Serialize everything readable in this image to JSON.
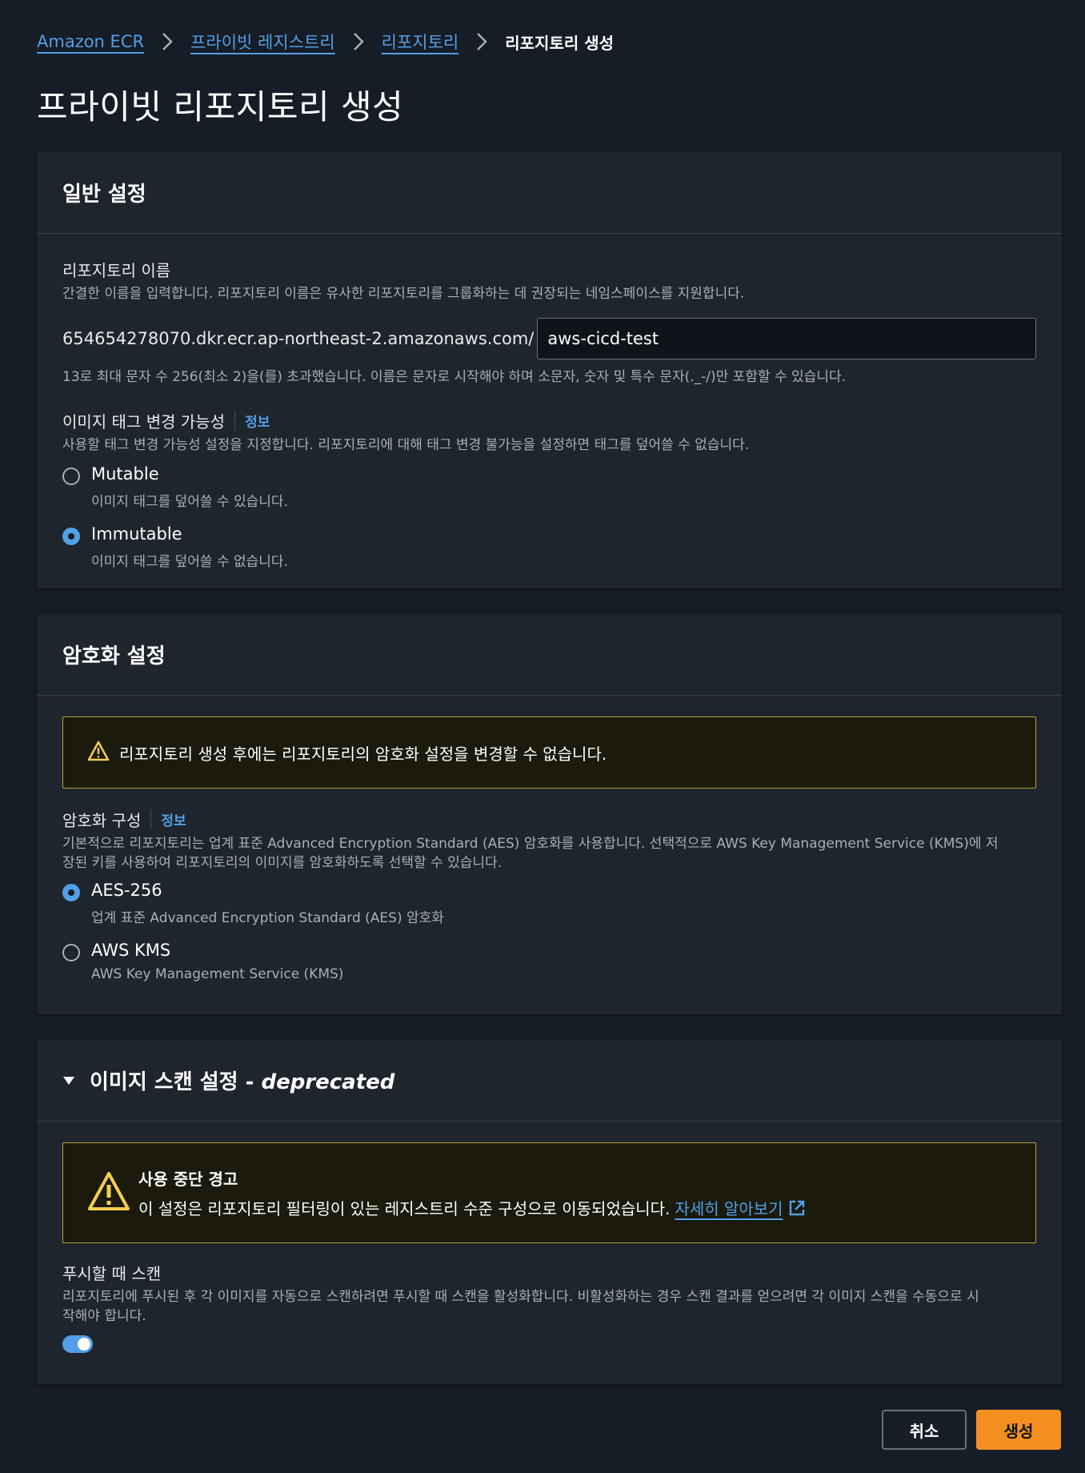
{
  "breadcrumb": {
    "items": [
      "Amazon ECR",
      "프라이빗 레지스트리",
      "리포지토리"
    ],
    "current": "리포지토리 생성"
  },
  "page_title": "프라이빗 리포지토리 생성",
  "general": {
    "title": "일반 설정",
    "repo_name_label": "리포지토리 이름",
    "repo_name_desc": "간결한 이름을 입력합니다. 리포지토리 이름은 유사한 리포지토리를 그룹화하는 데 권장되는 네임스페이스를 지원합니다.",
    "repo_prefix": "654654278070.dkr.ecr.ap-northeast-2.amazonaws.com/",
    "repo_value": "aws-cicd-test",
    "repo_hint": "13로 최대 문자 수 256(최소 2)을(를) 초과했습니다. 이름은 문자로 시작해야 하며 소문자, 숫자 및 특수 문자(._-/)만 포함할 수 있습니다.",
    "tag_label": "이미지 태그 변경 가능성",
    "info": "정보",
    "tag_desc": "사용할 태그 변경 가능성 설정을 지정합니다. 리포지토리에 대해 태그 변경 불가능을 설정하면 태그를 덮어쓸 수 없습니다.",
    "options": [
      {
        "label": "Mutable",
        "desc": "이미지 태그를 덮어쓸 수 있습니다.",
        "checked": false
      },
      {
        "label": "Immutable",
        "desc": "이미지 태그를 덮어쓸 수 없습니다.",
        "checked": true
      }
    ]
  },
  "encryption": {
    "title": "암호화 설정",
    "alert": "리포지토리 생성 후에는 리포지토리의 암호화 설정을 변경할 수 없습니다.",
    "config_label": "암호화 구성",
    "info": "정보",
    "config_desc_1": "기본적으로 리포지토리는 업계 표준 Advanced Encryption Standard (AES) 암호화를 사용합니다. 선택적으로 AWS Key Management Service (KMS)에 저",
    "config_desc_2": "장된 키를 사용하여 리포지토리의 이미지를 암호화하도록 선택할 수 있습니다.",
    "options": [
      {
        "label": "AES-256",
        "desc": "업계 표준 Advanced Encryption Standard (AES) 암호화",
        "checked": true
      },
      {
        "label": "AWS KMS",
        "desc": "AWS Key Management Service (KMS)",
        "checked": false
      }
    ]
  },
  "scan": {
    "title_main": "이미지 스캔 설정 - ",
    "title_italic": "deprecated",
    "alert_title": "사용 중단 경고",
    "alert_text": "이 설정은 리포지토리 필터링이 있는 레지스트리 수준 구성으로 이동되었습니다.",
    "alert_link": "자세히 알아보기",
    "push_label": "푸시할 때 스캔",
    "push_desc_1": "리포지토리에 푸시된 후 각 이미지를 자동으로 스캔하려면 푸시할 때 스캔을 활성화합니다. 비활성화하는 경우 스캔 결과를 얻으려면 각 이미지 스캔을 수동으로 시",
    "push_desc_2": "작해야 합니다.",
    "push_enabled": true
  },
  "actions": {
    "cancel": "취소",
    "create": "생성"
  }
}
